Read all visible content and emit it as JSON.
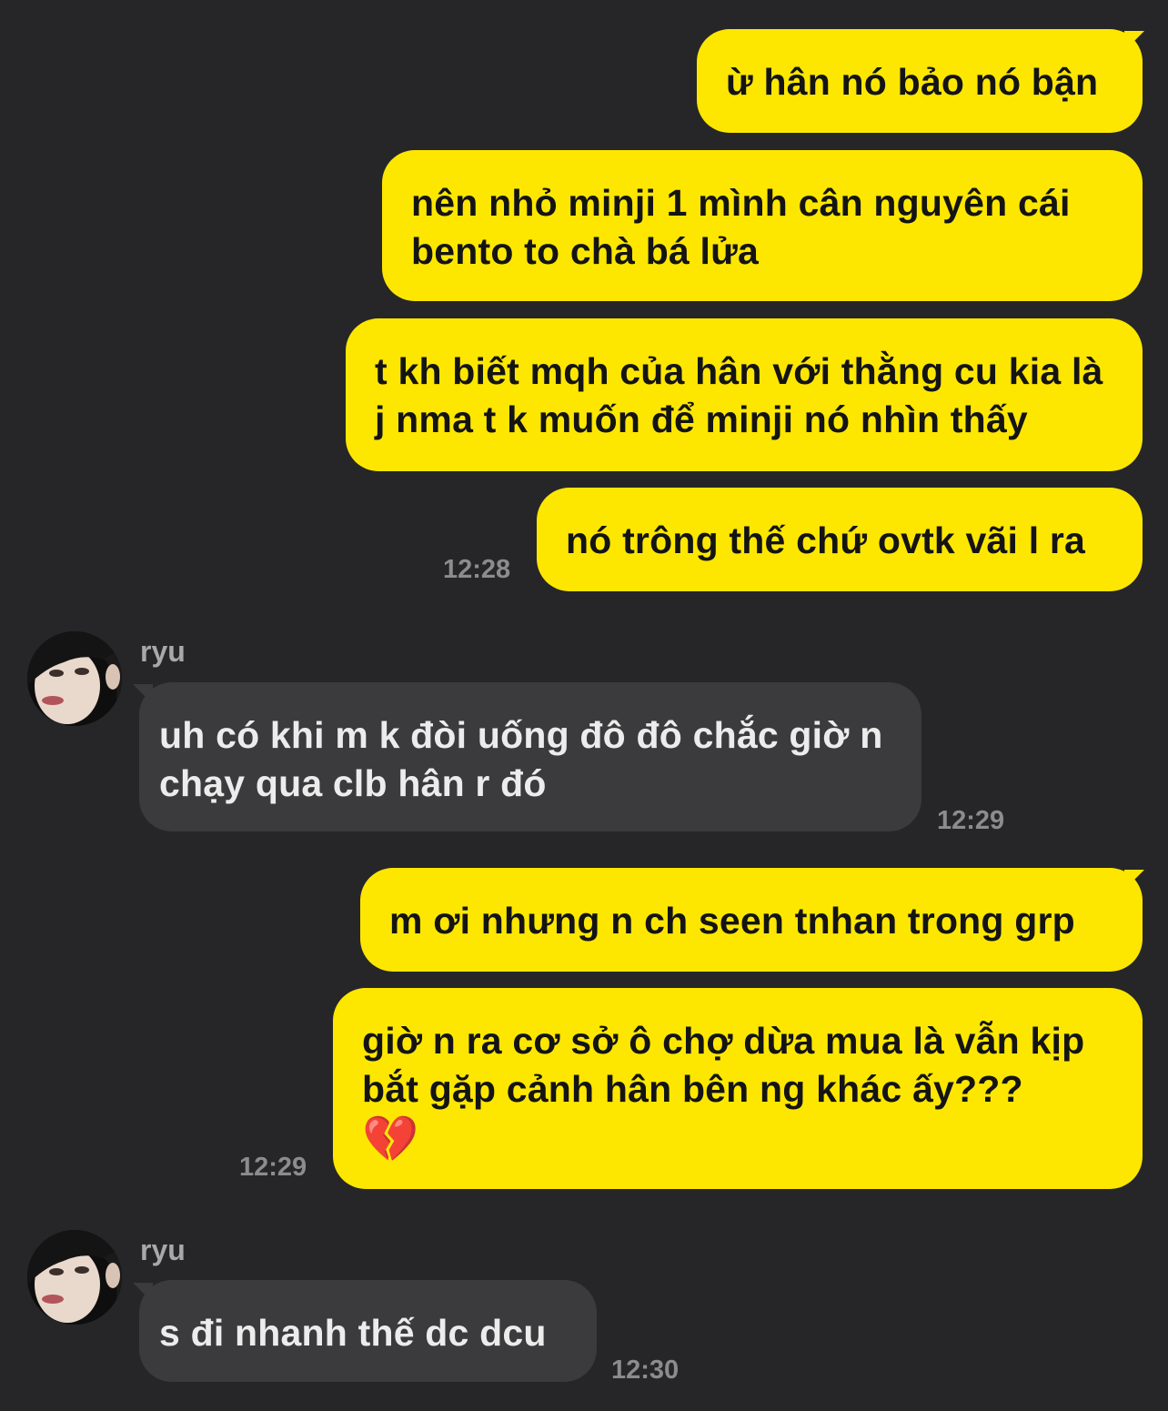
{
  "colors": {
    "background": "#262628",
    "outgoing_bubble": "#fde700",
    "incoming_bubble": "#3b3b3d",
    "timestamp": "#8c8c8e"
  },
  "messages": [
    {
      "direction": "outgoing",
      "text": "ừ hân nó bảo nó bận"
    },
    {
      "direction": "outgoing",
      "text": "nên nhỏ minji 1 mình cân nguyên cái bento to chà bá lửa"
    },
    {
      "direction": "outgoing",
      "text": "t kh biết mqh của hân với thằng cu kia là j nma t k muốn để minji nó nhìn thấy"
    },
    {
      "direction": "outgoing",
      "text": "nó trông thế chứ ovtk vãi l ra",
      "time": "12:28"
    },
    {
      "direction": "incoming",
      "sender": "ryu",
      "avatar_icon": "profile-photo",
      "text": "uh có khi m k đòi uống đô đô chắc giờ n chạy qua clb hân r đó",
      "time": "12:29"
    },
    {
      "direction": "outgoing",
      "text": "m ơi nhưng n ch seen tnhan trong grp"
    },
    {
      "direction": "outgoing",
      "text": "giờ n ra cơ sở ô chợ dừa mua là vẫn kịp bắt gặp cảnh hân bên ng khác ấy???",
      "emoji": "💔",
      "time": "12:29"
    },
    {
      "direction": "incoming",
      "sender": "ryu",
      "avatar_icon": "profile-photo",
      "text": "s đi nhanh thế dc dcu",
      "time": "12:30"
    }
  ]
}
